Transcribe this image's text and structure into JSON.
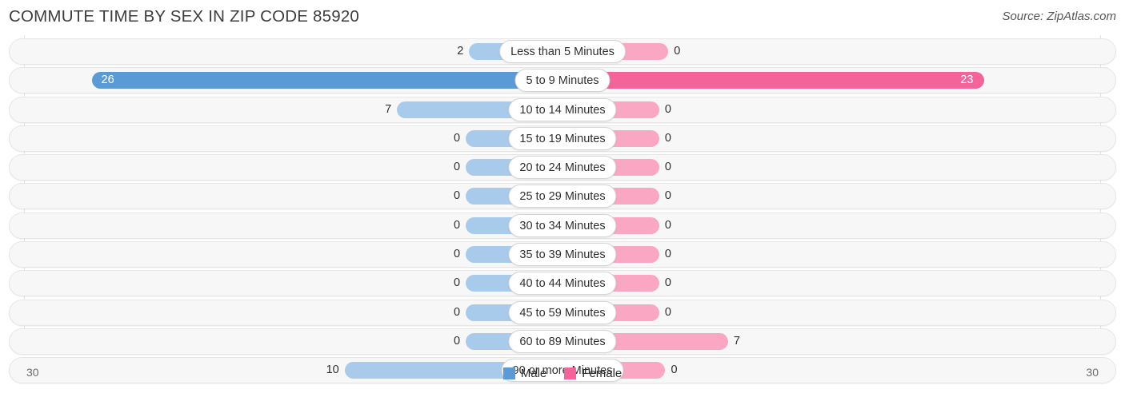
{
  "header": {
    "title": "COMMUTE TIME BY SEX IN ZIP CODE 85920",
    "source": "Source: ZipAtlas.com"
  },
  "legend": {
    "male_label": "Male",
    "female_label": "Female"
  },
  "axis": {
    "left_label": "30",
    "right_label": "30"
  },
  "colors": {
    "male_strong": "#5b9bd5",
    "male_light": "#a8cbec",
    "female_strong": "#f4649a",
    "female_light": "#f9a7c3",
    "track": "#f7f7f7",
    "track_border": "#e6e6e6"
  },
  "chart_data": {
    "type": "bar",
    "orientation": "horizontal",
    "style": "diverging-bidirectional",
    "title": "COMMUTE TIME BY SEX IN ZIP CODE 85920",
    "subtitle": "Source: ZipAtlas.com",
    "xlabel": "",
    "ylabel": "",
    "xlim": [
      30,
      30
    ],
    "axis_left_max": 30,
    "axis_right_max": 30,
    "grid": false,
    "legend_position": "bottom-center",
    "categories": [
      "Less than 5 Minutes",
      "5 to 9 Minutes",
      "10 to 14 Minutes",
      "15 to 19 Minutes",
      "20 to 24 Minutes",
      "25 to 29 Minutes",
      "30 to 34 Minutes",
      "35 to 39 Minutes",
      "40 to 44 Minutes",
      "45 to 59 Minutes",
      "60 to 89 Minutes",
      "90 or more Minutes"
    ],
    "series": [
      {
        "name": "Male",
        "color": "#5b9bd5",
        "values": [
          2,
          26,
          7,
          0,
          0,
          0,
          0,
          0,
          0,
          0,
          0,
          10
        ]
      },
      {
        "name": "Female",
        "color": "#f4649a",
        "values": [
          0,
          23,
          0,
          0,
          0,
          0,
          0,
          0,
          0,
          0,
          7,
          0
        ]
      }
    ]
  },
  "rows": [
    {
      "label": "Less than 5 Minutes",
      "male": "2",
      "female": "0"
    },
    {
      "label": "5 to 9 Minutes",
      "male": "26",
      "female": "23"
    },
    {
      "label": "10 to 14 Minutes",
      "male": "7",
      "female": "0"
    },
    {
      "label": "15 to 19 Minutes",
      "male": "0",
      "female": "0"
    },
    {
      "label": "20 to 24 Minutes",
      "male": "0",
      "female": "0"
    },
    {
      "label": "25 to 29 Minutes",
      "male": "0",
      "female": "0"
    },
    {
      "label": "30 to 34 Minutes",
      "male": "0",
      "female": "0"
    },
    {
      "label": "35 to 39 Minutes",
      "male": "0",
      "female": "0"
    },
    {
      "label": "40 to 44 Minutes",
      "male": "0",
      "female": "0"
    },
    {
      "label": "45 to 59 Minutes",
      "male": "0",
      "female": "0"
    },
    {
      "label": "60 to 89 Minutes",
      "male": "0",
      "female": "7"
    },
    {
      "label": "90 or more Minutes",
      "male": "10",
      "female": "0"
    }
  ]
}
